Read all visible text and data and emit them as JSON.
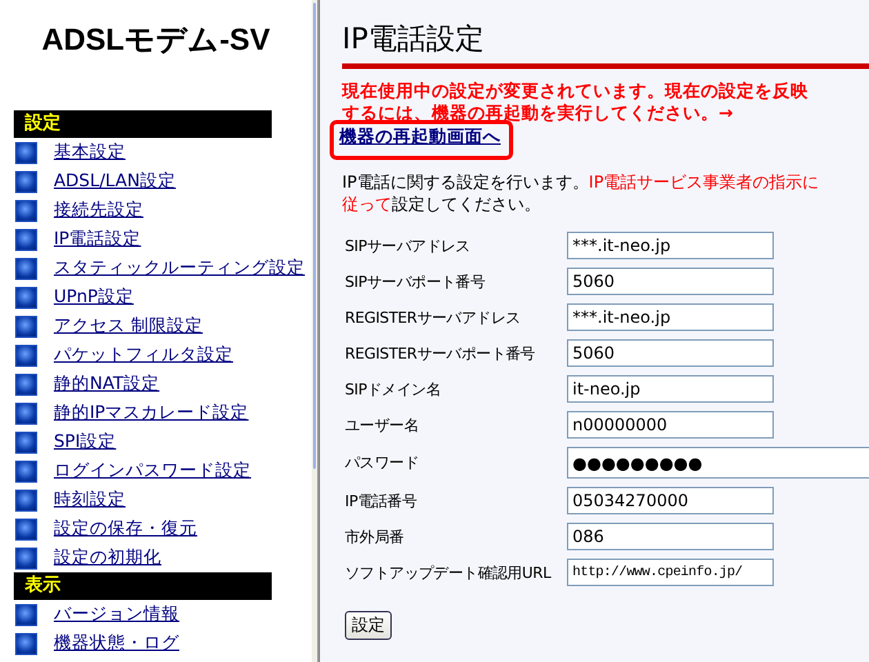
{
  "sidebar": {
    "logo": "ADSLモデム-SV",
    "sections": [
      {
        "title": "設定",
        "items": [
          {
            "label": "基本設定"
          },
          {
            "label": "ADSL/LAN設定"
          },
          {
            "label": "接続先設定"
          },
          {
            "label": "IP電話設定"
          },
          {
            "label": "スタティックルーティング設定"
          },
          {
            "label": "UPnP設定"
          },
          {
            "label": "アクセス 制限設定"
          },
          {
            "label": "パケットフィルタ設定"
          },
          {
            "label": "静的NAT設定"
          },
          {
            "label": "静的IPマスカレード設定"
          },
          {
            "label": "SPI設定"
          },
          {
            "label": "ログインパスワード設定"
          },
          {
            "label": "時刻設定"
          },
          {
            "label": "設定の保存・復元"
          },
          {
            "label": "設定の初期化"
          }
        ]
      },
      {
        "title": "表示",
        "items": [
          {
            "label": "バージョン情報"
          },
          {
            "label": "機器状態・ログ"
          }
        ]
      }
    ]
  },
  "main": {
    "title": "IP電話設定",
    "notice": "現在使用中の設定が変更されています。現在の設定を反映するには、機器の再起動を実行してください。→",
    "notice_link": "機器の再起動画面へ",
    "description": "IP電話に関する設定を行います。",
    "description_highlight": "IP電話サービス事業者の指示に従って",
    "description_end": "設定してください。",
    "fields": [
      {
        "label": "SIPサーバアドレス",
        "value": "***.it-neo.jp"
      },
      {
        "label": "SIPサーバポート番号",
        "value": "5060"
      },
      {
        "label": "REGISTERサーバアドレス",
        "value": "***.it-neo.jp"
      },
      {
        "label": "REGISTERサーバポート番号",
        "value": "5060"
      },
      {
        "label": "SIPドメイン名",
        "value": "it-neo.jp"
      },
      {
        "label": "ユーザー名",
        "value": "n00000000"
      },
      {
        "label": "パスワード",
        "value": "●●●●●●●●●",
        "kind": "password"
      },
      {
        "label": "IP電話番号",
        "value": "05034270000"
      },
      {
        "label": "市外局番",
        "value": "086"
      },
      {
        "label": "ソフトアップデート確認用URL",
        "value": "http://www.cpeinfo.jp/",
        "kind": "mono"
      }
    ],
    "submit": "設定"
  }
}
